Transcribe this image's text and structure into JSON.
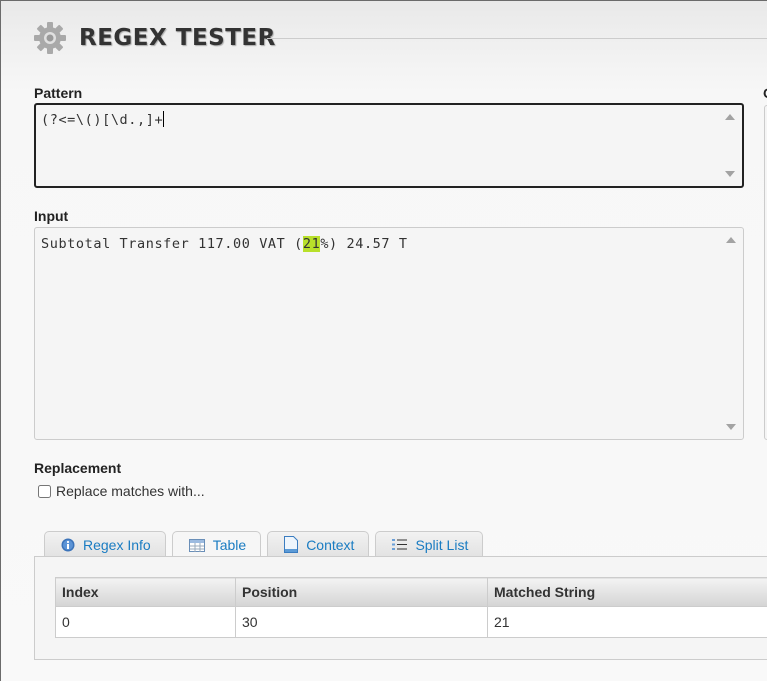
{
  "header": {
    "title": "REGEX TESTER"
  },
  "pattern": {
    "label": "Pattern",
    "value": "(?<=\\()[\\d.,]+"
  },
  "options": {
    "label_partial": "O"
  },
  "input": {
    "label": "Input",
    "before": "Subtotal Transfer 117.00 VAT (",
    "match": "21",
    "after": "%) 24.57 T"
  },
  "replacement": {
    "label": "Replacement",
    "checkbox_label": "Replace matches with...",
    "checked": false
  },
  "tabs": [
    {
      "label": "Regex Info",
      "icon": "info-icon"
    },
    {
      "label": "Table",
      "icon": "table-icon",
      "active": true
    },
    {
      "label": "Context",
      "icon": "document-icon"
    },
    {
      "label": "Split List",
      "icon": "list-icon"
    }
  ],
  "table": {
    "headers": [
      "Index",
      "Position",
      "Matched String"
    ],
    "rows": [
      [
        "0",
        "30",
        "21"
      ]
    ]
  },
  "colors": {
    "highlight": "#b8e02a",
    "tab_text": "#1a7cc2"
  }
}
